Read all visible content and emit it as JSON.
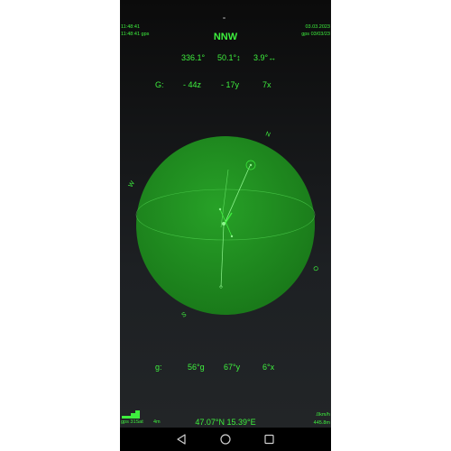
{
  "status": {
    "time_left": "11:48:41",
    "gps_time_left": "11:48:41 gps",
    "date_right": "03.03.2023",
    "gps_date_right": "gps 03/03/23"
  },
  "heading": {
    "direction": "NNW"
  },
  "readings": {
    "azimuth": "336.1°",
    "pitch": "50.1°↕",
    "roll": "3.9°↔"
  },
  "g_top": {
    "label": "G:",
    "z": "- 44z",
    "y": "- 17y",
    "x": "7x"
  },
  "compass": {
    "north": "N",
    "west": "W",
    "south": "S",
    "east": "O"
  },
  "g_bottom": {
    "label": "g:",
    "g": "56°g",
    "y": "67°y",
    "x": "6°x"
  },
  "bottom": {
    "gps_sat": "gps  31Sat",
    "accuracy": "4m",
    "coords": "47.07°N  15.39°E",
    "speed": ".0km/h",
    "altitude": "445.8m"
  },
  "colors": {
    "accent": "#3ef03e",
    "sphere": "#1f8a1f",
    "background": "#1d2023"
  },
  "icons": [
    "back-icon",
    "home-icon",
    "recents-icon"
  ]
}
